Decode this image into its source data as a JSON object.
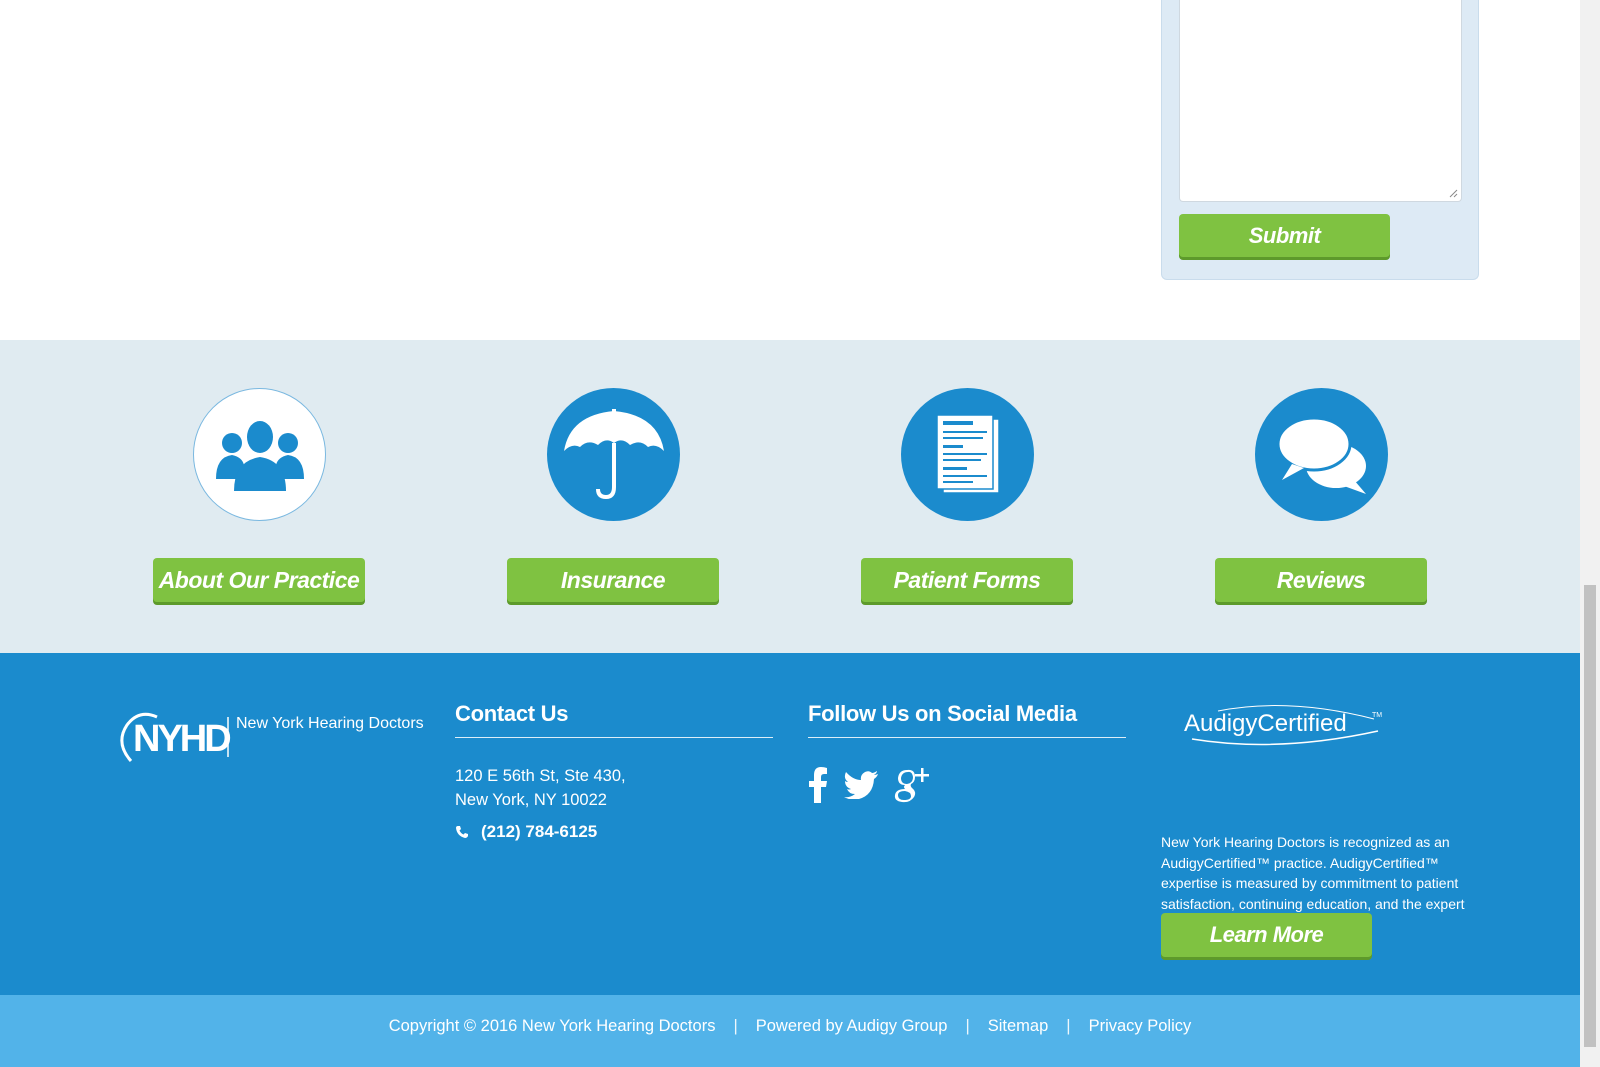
{
  "form": {
    "submit_label": "Submit"
  },
  "features": [
    {
      "label": "About Our Practice",
      "icon": "people-icon"
    },
    {
      "label": "Insurance",
      "icon": "umbrella-icon"
    },
    {
      "label": "Patient Forms",
      "icon": "document-icon"
    },
    {
      "label": "Reviews",
      "icon": "chat-bubbles-icon"
    }
  ],
  "footer": {
    "logo_mark": "NYHD",
    "logo_text": "New York Hearing Doctors",
    "contact": {
      "heading": "Contact Us",
      "address_line1": "120 E 56th St, Ste 430,",
      "address_line2": "New York, NY 10022",
      "phone": "(212) 784-6125"
    },
    "social": {
      "heading": "Follow Us on Social Media",
      "icons": [
        "facebook-icon",
        "twitter-icon",
        "google-plus-icon"
      ]
    },
    "audigy": {
      "logo_text": "AudigyCertified",
      "description": "New York Hearing Doctors is recognized as an AudigyCertified™ practice. AudigyCertified™ expertise is measured by commitment to patient satisfaction, continuing education, and the expert application of current technology.",
      "learn_more_label": "Learn More"
    }
  },
  "bottom_bar": {
    "copyright": "Copyright © 2016 New York Hearing Doctors",
    "powered_by": "Powered by Audigy Group",
    "sitemap": "Sitemap",
    "privacy": "Privacy Policy",
    "separator": "|"
  },
  "colors": {
    "brand_blue": "#1b8bcd",
    "light_blue": "#52b3e9",
    "strip_bg": "#e0ebf1",
    "button_green": "#7fc241"
  }
}
